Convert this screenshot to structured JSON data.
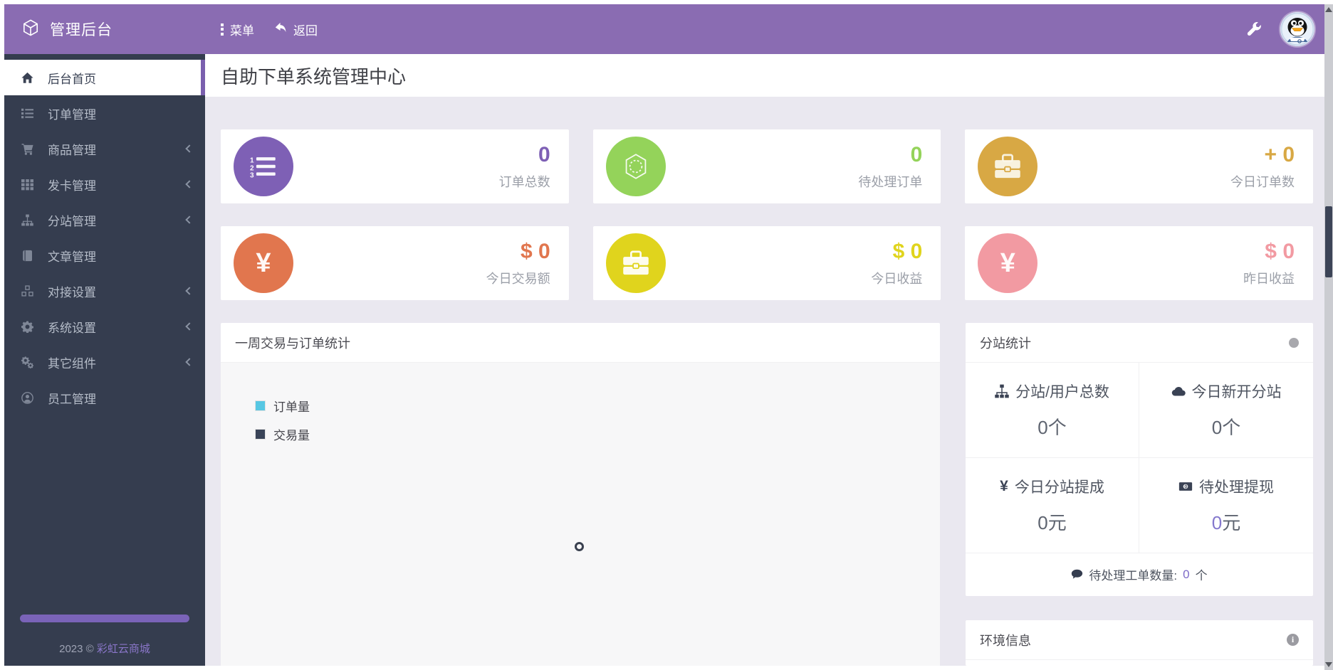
{
  "topbar": {
    "brand": "管理后台",
    "menu_label": "菜单",
    "back_label": "返回"
  },
  "sidebar": {
    "items": [
      {
        "label": "后台首页",
        "active": true,
        "has_children": false
      },
      {
        "label": "订单管理",
        "active": false,
        "has_children": false
      },
      {
        "label": "商品管理",
        "active": false,
        "has_children": true
      },
      {
        "label": "发卡管理",
        "active": false,
        "has_children": true
      },
      {
        "label": "分站管理",
        "active": false,
        "has_children": true
      },
      {
        "label": "文章管理",
        "active": false,
        "has_children": false
      },
      {
        "label": "对接设置",
        "active": false,
        "has_children": true
      },
      {
        "label": "系统设置",
        "active": false,
        "has_children": true
      },
      {
        "label": "其它组件",
        "active": false,
        "has_children": true
      },
      {
        "label": "员工管理",
        "active": false,
        "has_children": false
      }
    ],
    "footer_year": "2023 © ",
    "footer_brand": "彩虹云商城"
  },
  "page": {
    "title": "自助下单系统管理中心"
  },
  "stat_cards": [
    {
      "value": "0",
      "label": "订单总数",
      "color": "#7e60b5"
    },
    {
      "value": "0",
      "label": "待处理订单",
      "color": "#94d35a"
    },
    {
      "value": "+ 0",
      "label": "今日订单数",
      "color": "#d8a844"
    },
    {
      "value": "$ 0",
      "label": "今日交易额",
      "color": "#e1764e"
    },
    {
      "value": "$ 0",
      "label": "今日收益",
      "color": "#e0d41d"
    },
    {
      "value": "$ 0",
      "label": "昨日收益",
      "color": "#f29aa2"
    }
  ],
  "icons": {
    "yen_glyph": "¥"
  },
  "chart_panel": {
    "title": "一周交易与订单统计",
    "legend": [
      {
        "label": "订单量",
        "color": "#57c7e3"
      },
      {
        "label": "交易量",
        "color": "#3a4458"
      }
    ],
    "state": "loading"
  },
  "substation_panel": {
    "title": "分站统计",
    "cells": [
      {
        "title": "分站/用户总数",
        "value": "0",
        "unit": "个"
      },
      {
        "title": "今日新开分站",
        "value": "0",
        "unit": "个"
      },
      {
        "title": "今日分站提成",
        "value": "0",
        "unit": "元"
      },
      {
        "title": "待处理提现",
        "value": "0",
        "unit": "元"
      }
    ],
    "ticket_label": "待处理工单数量: ",
    "ticket_value": "0",
    "ticket_unit": "个"
  },
  "env_panel": {
    "title": "环境信息"
  },
  "colors": {
    "topbar": "#8a6cb2",
    "sidebar_bg": "#353d4f",
    "accent_purple": "#7a5fae",
    "content_bg": "#eae8f0",
    "link_purple": "#8478cd"
  }
}
